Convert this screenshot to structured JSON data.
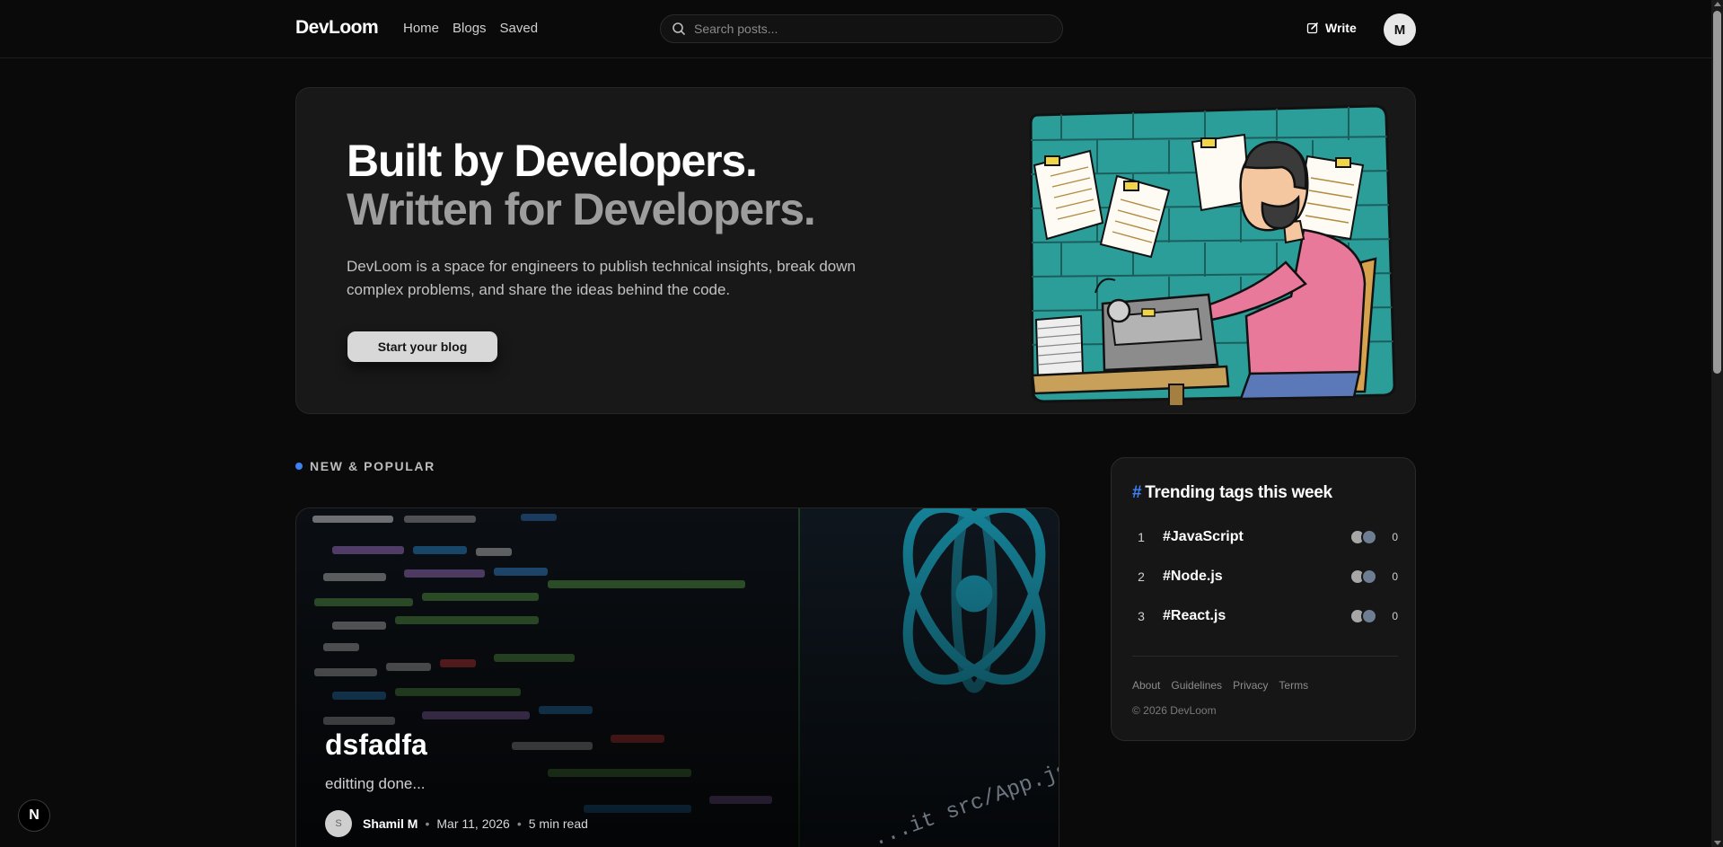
{
  "nav": {
    "logo": "DevLoom",
    "links": [
      "Home",
      "Blogs",
      "Saved"
    ],
    "search_placeholder": "Search posts...",
    "write_label": "Write",
    "avatar_initial": "M"
  },
  "hero": {
    "title_line1": "Built by Developers.",
    "title_line2": "Written for Developers.",
    "description": "DevLoom is a space for engineers to publish technical insights, break down complex problems, and share the ideas behind the code.",
    "cta_label": "Start your blog"
  },
  "section": {
    "label": "NEW & POPULAR",
    "accent_color": "#3b82f6"
  },
  "post": {
    "title": "dsfadfa",
    "excerpt": "editting done...",
    "author_initial": "S",
    "author": "Shamil M",
    "date": "Mar 11, 2026",
    "read_time": "5 min read",
    "image_code_text": "...it src/App.js and save to"
  },
  "sidebar": {
    "title": "Trending tags this week",
    "hash_symbol": "#",
    "tags": [
      {
        "rank": "1",
        "name": "#JavaScript",
        "count": "0"
      },
      {
        "rank": "2",
        "name": "#Node.js",
        "count": "0"
      },
      {
        "rank": "3",
        "name": "#React.js",
        "count": "0"
      }
    ],
    "footer_links": [
      "About",
      "Guidelines",
      "Privacy",
      "Terms"
    ],
    "copyright": "© 2026 DevLoom"
  },
  "badge": {
    "label": "N"
  },
  "icons": {
    "search": "search-icon",
    "write": "pen-square-icon"
  }
}
